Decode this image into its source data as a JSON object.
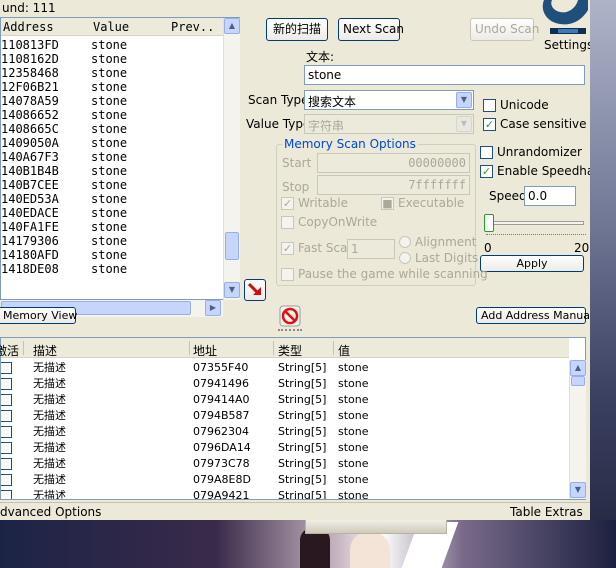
{
  "found_label": "und: 111",
  "results": {
    "headers": [
      "Address",
      "Value",
      "Prev.."
    ],
    "rows": [
      {
        "address": "110813FD",
        "value": "stone"
      },
      {
        "address": "1108162D",
        "value": "stone"
      },
      {
        "address": "12358468",
        "value": "stone"
      },
      {
        "address": "12F06B21",
        "value": "stone"
      },
      {
        "address": "14078A59",
        "value": "stone"
      },
      {
        "address": "14086652",
        "value": "stone"
      },
      {
        "address": "1408665C",
        "value": "stone"
      },
      {
        "address": "1409050A",
        "value": "stone"
      },
      {
        "address": "140A67F3",
        "value": "stone"
      },
      {
        "address": "140B1B4B",
        "value": "stone"
      },
      {
        "address": "140B7CEE",
        "value": "stone"
      },
      {
        "address": "140ED53A",
        "value": "stone"
      },
      {
        "address": "140EDACE",
        "value": "stone"
      },
      {
        "address": "140FA1FE",
        "value": "stone"
      },
      {
        "address": "14179306",
        "value": "stone"
      },
      {
        "address": "14180AFD",
        "value": "stone"
      },
      {
        "address": "1418DE08",
        "value": "stone"
      }
    ]
  },
  "buttons": {
    "new_scan": "新的扫描",
    "next_scan": "Next Scan",
    "undo_scan": "Undo Scan",
    "settings": "Settings",
    "apply": "Apply",
    "memory_view": "Memory View",
    "add_address": "Add Address Manually"
  },
  "scan": {
    "text_label": "文本:",
    "text_value": "stone",
    "scan_type_label": "Scan Type",
    "scan_type_value": "搜索文本",
    "value_type_label": "Value Type",
    "value_type_value": "字符串"
  },
  "options": {
    "unicode": "Unicode",
    "case_sensitive": "Case sensitive",
    "unrandomizer": "Unrandomizer",
    "enable_speedhack": "Enable Speedhack",
    "speed_label": "Speed",
    "speed_value": "0.0",
    "slider_min": "0",
    "slider_max": "20"
  },
  "memory_options": {
    "title": "Memory Scan Options",
    "start_label": "Start",
    "start_value": "00000000",
    "stop_label": "Stop",
    "stop_value": "7fffffff",
    "writable": "Writable",
    "executable": "Executable",
    "copy_on_write": "CopyOnWrite",
    "fast_scan": "Fast Scan",
    "fast_scan_value": "1",
    "alignment": "Alignment",
    "last_digits": "Last Digits",
    "pause_game": "Pause the game while scanning"
  },
  "table": {
    "headers": [
      "激活",
      "描述",
      "地址",
      "类型",
      "值"
    ],
    "rows": [
      {
        "desc": "无描述",
        "address": "07355F40",
        "type": "String[5]",
        "value": "stone"
      },
      {
        "desc": "无描述",
        "address": "07941496",
        "type": "String[5]",
        "value": "stone"
      },
      {
        "desc": "无描述",
        "address": "079414A0",
        "type": "String[5]",
        "value": "stone"
      },
      {
        "desc": "无描述",
        "address": "0794B587",
        "type": "String[5]",
        "value": "stone"
      },
      {
        "desc": "无描述",
        "address": "07962304",
        "type": "String[5]",
        "value": "stone"
      },
      {
        "desc": "无描述",
        "address": "0796DA14",
        "type": "String[5]",
        "value": "stone"
      },
      {
        "desc": "无描述",
        "address": "07973C78",
        "type": "String[5]",
        "value": "stone"
      },
      {
        "desc": "无描述",
        "address": "079A8E8D",
        "type": "String[5]",
        "value": "stone"
      },
      {
        "desc": "无描述",
        "address": "079A9421",
        "type": "String[5]",
        "value": "stone"
      }
    ]
  },
  "bottom": {
    "advanced_options": "dvanced Options",
    "table_extras": "Table Extras"
  },
  "colors": {
    "window_bg": "#ece9d8",
    "accent_blue": "#0046d5",
    "check_green": "#21a121"
  },
  "icons": {
    "arrow_to_table": "red-diagonal-arrow-icon",
    "clear_list": "red-no-entry-icon"
  }
}
